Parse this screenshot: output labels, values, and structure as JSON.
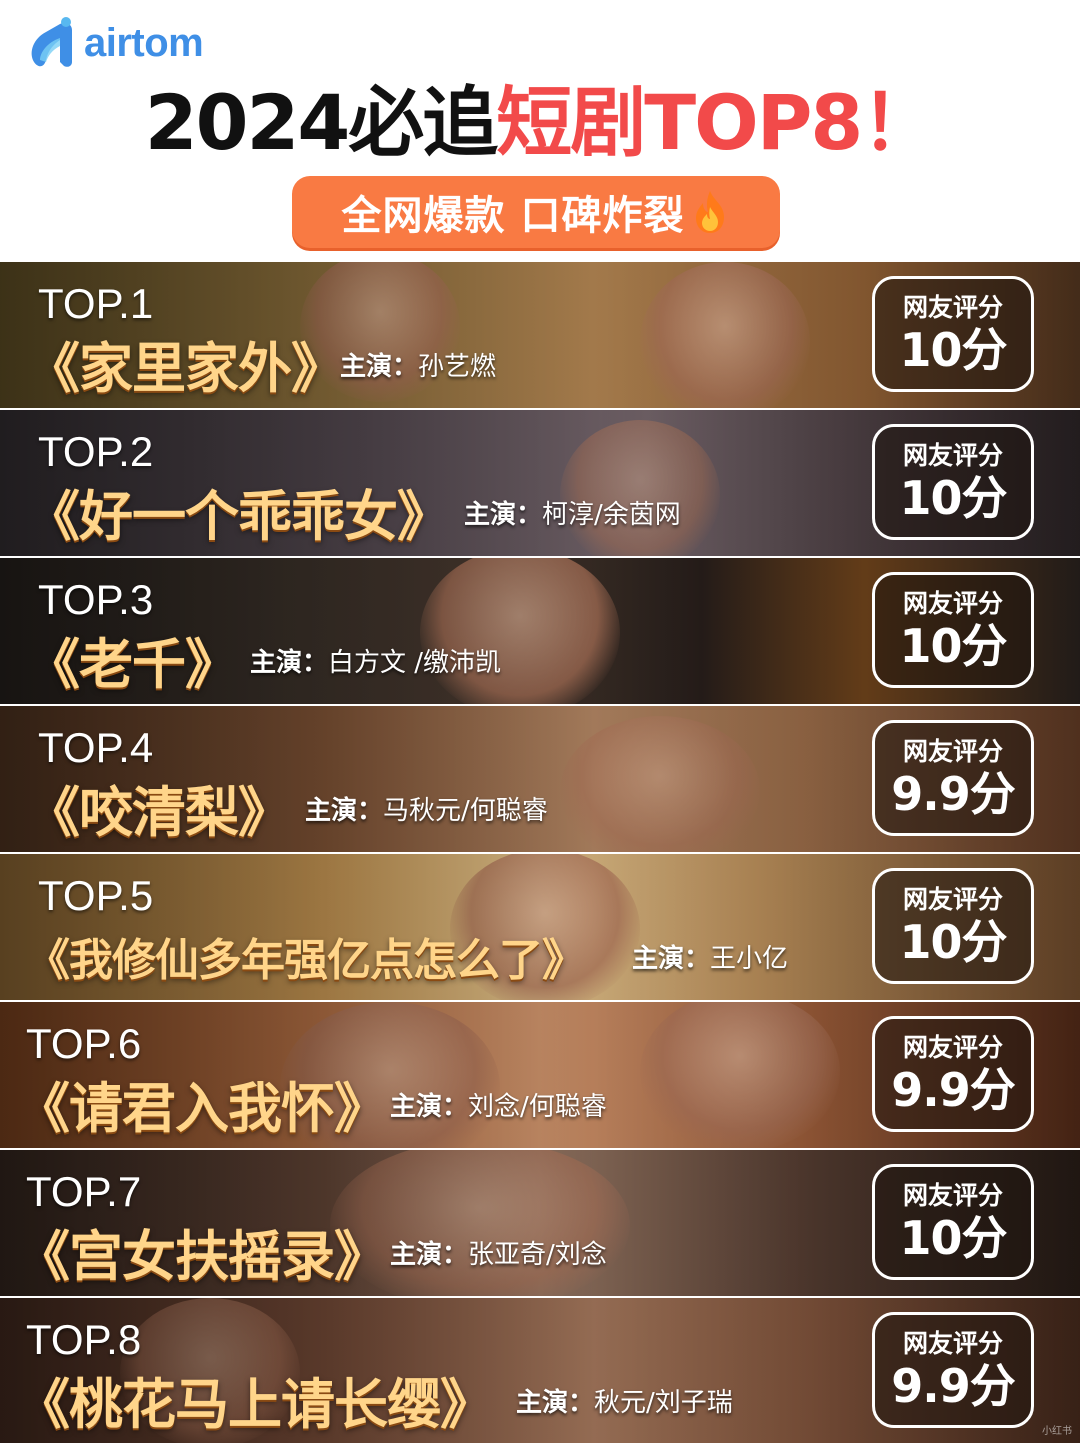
{
  "brand": {
    "logo_text": "airtom",
    "color": "#3f8fe6"
  },
  "header": {
    "title_black": "2024必追",
    "title_red": "短剧TOP8！",
    "subtitle": "全网爆款 口碑炸裂",
    "subtitle_icon": "fire-icon",
    "accent_red": "#f24a4a",
    "accent_orange": "#f97a43"
  },
  "score_label": "网友评分",
  "cast_label": "主演：",
  "rankings": [
    {
      "rank": "TOP.1",
      "title": "《家里家外》",
      "cast": "孙艺燃",
      "score": "10分"
    },
    {
      "rank": "TOP.2",
      "title": "《好一个乖乖女》",
      "cast": "柯淳/余茵网",
      "score": "10分"
    },
    {
      "rank": "TOP.3",
      "title": "《老千》",
      "cast": "白方文 /缴沛凯",
      "score": "10分"
    },
    {
      "rank": "TOP.4",
      "title": "《咬清梨》",
      "cast": "马秋元/何聪睿",
      "score": "9.9分"
    },
    {
      "rank": "TOP.5",
      "title": "《我修仙多年强亿点怎么了》",
      "cast": "王小亿",
      "score": "10分"
    },
    {
      "rank": "TOP.6",
      "title": "《请君入我怀》",
      "cast": "刘念/何聪睿",
      "score": "9.9分"
    },
    {
      "rank": "TOP.7",
      "title": "《宫女扶摇录》",
      "cast": "张亚奇/刘念",
      "score": "10分"
    },
    {
      "rank": "TOP.8",
      "title": "《桃花马上请长缨》",
      "cast": "秋元/刘子瑞",
      "score": "9.9分"
    }
  ],
  "watermark": "小红书"
}
